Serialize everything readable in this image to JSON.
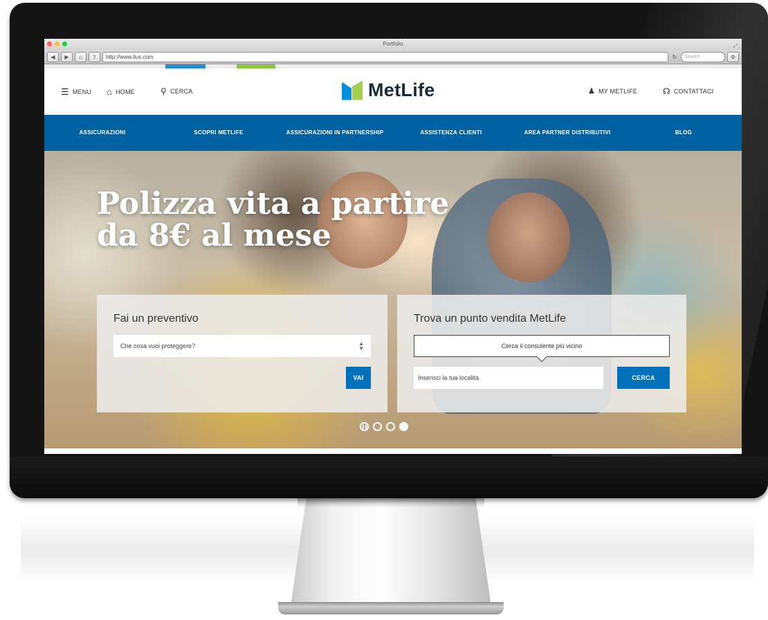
{
  "browser": {
    "window_title": "Portfolio",
    "url": "http://www.ilus.com",
    "search_placeholder": "Search",
    "back": "◀",
    "forward": "▶"
  },
  "header": {
    "menu_label": "MENU",
    "home_label": "HOME",
    "search_label": "CERCA",
    "logo_text": "MetLife",
    "my_metlife_label": "MY METLIFE",
    "contact_label": "CONTATTACI"
  },
  "nav": {
    "items": [
      {
        "label": "ASSICURAZIONI"
      },
      {
        "label": "SCOPRI METLIFE"
      },
      {
        "label": "ASSICURAZIONI IN PARTNERSHIP"
      },
      {
        "label": "ASSISTENZA CLIENTI"
      },
      {
        "label": "AREA PARTNER DISTRIBUTIVI"
      },
      {
        "label": "BLOG"
      }
    ]
  },
  "hero": {
    "headline_line1": "Polizza vita a partire",
    "headline_line2": "da 8€ al mese"
  },
  "quote_panel": {
    "title": "Fai un preventivo",
    "select_value": "Che cosa vuoi proteggere?",
    "button_label": "VAI"
  },
  "store_panel": {
    "title": "Trova un punto vendita MetLife",
    "consultant_button": "Cerca il consulente più vicino",
    "location_placeholder": "Inserisci la tua località",
    "button_label": "CERCA"
  },
  "carousel": {
    "slide_count": 3,
    "active_slide": 3
  },
  "colors": {
    "nav_blue": "#0061a0",
    "button_blue": "#0072bc",
    "logo_blue": "#0090da",
    "logo_green": "#a4ce4e"
  }
}
